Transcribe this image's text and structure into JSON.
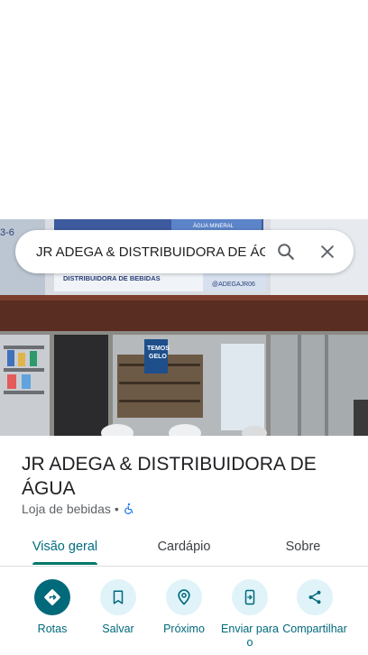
{
  "search": {
    "query": "JR ADEGA & DISTRIBUIDORA DE ÁG"
  },
  "photo": {
    "signs": {
      "top_right": "ÁGUA MINERAL",
      "banner_left": "DISTRIBUIDORA DE BEBIDAS",
      "banner_right": "@ADEGAJR06",
      "fridge_sign_line1": "TEMOS",
      "fridge_sign_line2": "GELO",
      "left_edge": "3-6"
    }
  },
  "place": {
    "title": "JR ADEGA & DISTRIBUIDORA DE ÁGUA",
    "category": "Loja de bebidas",
    "separator": "•"
  },
  "tabs": [
    {
      "label": "Visão geral",
      "active": true
    },
    {
      "label": "Cardápio",
      "active": false
    },
    {
      "label": "Sobre",
      "active": false
    }
  ],
  "actions": [
    {
      "label": "Rotas",
      "icon": "directions-icon"
    },
    {
      "label": "Salvar",
      "icon": "bookmark-icon"
    },
    {
      "label": "Próximo",
      "icon": "nearby-icon"
    },
    {
      "label": "Enviar para o",
      "icon": "send-to-phone-icon"
    },
    {
      "label": "Compartilhar",
      "icon": "share-icon"
    }
  ],
  "colors": {
    "accent": "#00697a",
    "action_bg": "#dff3f9",
    "tab_indicator": "#00796b",
    "accessible_icon": "#1a73e8"
  }
}
